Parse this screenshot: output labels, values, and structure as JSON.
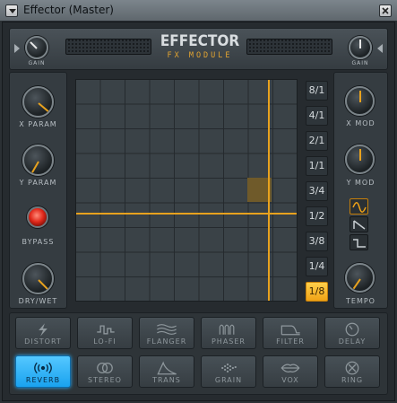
{
  "window": {
    "title": "Effector (Master)"
  },
  "header": {
    "brand": "EFFECTOR",
    "subtitle": "FX MODULE",
    "left_knob_label": "GAIN",
    "right_knob_label": "GAIN"
  },
  "left_panel": {
    "x_param_label": "X PARAM",
    "y_param_label": "Y PARAM",
    "bypass_label": "BYPASS",
    "dry_wet_label": "DRY/WET"
  },
  "right_panel": {
    "x_mod_label": "X MOD",
    "y_mod_label": "Y MOD",
    "tempo_label": "TEMPO"
  },
  "xy_pad": {
    "grid_divisions": 9,
    "cursor_x": 0.87,
    "cursor_y": 0.6,
    "highlight_cell_col": 7,
    "highlight_cell_row": 4
  },
  "rates": [
    {
      "label": "8/1",
      "active": false
    },
    {
      "label": "4/1",
      "active": false
    },
    {
      "label": "2/1",
      "active": false
    },
    {
      "label": "1/1",
      "active": false
    },
    {
      "label": "3/4",
      "active": false
    },
    {
      "label": "1/2",
      "active": false
    },
    {
      "label": "3/8",
      "active": false
    },
    {
      "label": "1/4",
      "active": false
    },
    {
      "label": "1/8",
      "active": true
    }
  ],
  "lfo_shapes": [
    "sine-wave-icon",
    "saw-wave-icon",
    "square-wave-icon"
  ],
  "effects": {
    "distort": "DISTORT",
    "lofi": "LO-FI",
    "flanger": "FLANGER",
    "phaser": "PHASER",
    "filter": "FILTER",
    "delay": "DELAY",
    "reverb": "REVERB",
    "stereo": "STEREO",
    "trans": "TRANS",
    "grain": "GRAIN",
    "vox": "VOX",
    "ring": "RING"
  },
  "active_effect": "REVERB",
  "colors": {
    "accent": "#e8a21e",
    "active_effect": "#19a2ef",
    "bypass": "#e0281a"
  }
}
